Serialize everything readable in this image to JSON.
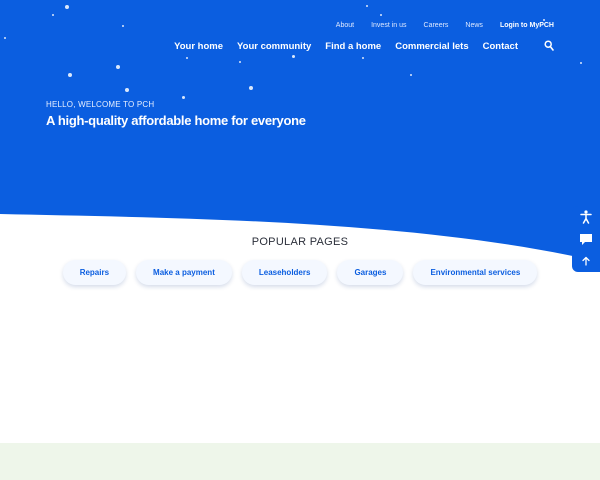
{
  "utility_nav": [
    "About",
    "Invest in us",
    "Careers",
    "News",
    "Login to MyPCH"
  ],
  "main_nav": [
    "Your home",
    "Your community",
    "Find a home",
    "Commercial lets",
    "Contact"
  ],
  "hero": {
    "greeting": "HELLO, WELCOME TO PCH",
    "headline": "A high-quality affordable home for everyone"
  },
  "popular": {
    "title": "POPULAR PAGES",
    "links": [
      "Repairs",
      "Make a payment",
      "Leaseholders",
      "Garages",
      "Environmental services"
    ]
  },
  "toolbar": {
    "icons": [
      "accessibility-icon",
      "chat-icon",
      "back-to-top-icon"
    ]
  },
  "colors": {
    "brand_blue": "#0b5ee0",
    "footer_tint": "#eef6ea"
  }
}
